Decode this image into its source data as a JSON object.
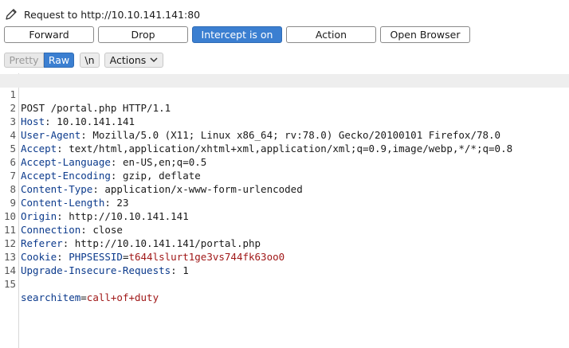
{
  "window": {
    "title": "Request to http://10.10.141.141:80",
    "icon": "pencil-icon"
  },
  "buttons": {
    "forward": "Forward",
    "drop": "Drop",
    "intercept": "Intercept is on",
    "action": "Action",
    "open_browser": "Open Browser"
  },
  "tabs": {
    "pretty": "Pretty",
    "raw": "Raw",
    "newline": "\\n",
    "actions": "Actions"
  },
  "colors": {
    "accent": "#3b7fd1",
    "header_name": "#0b3a8c",
    "param_value": "#a01818"
  },
  "request": {
    "line_numbers": [
      "1",
      "2",
      "3",
      "4",
      "5",
      "6",
      "7",
      "8",
      "9",
      "10",
      "11",
      "12",
      "13",
      "14",
      "15"
    ],
    "request_line": "POST /portal.php HTTP/1.1",
    "headers": [
      {
        "name": "Host",
        "value": "10.10.141.141"
      },
      {
        "name": "User-Agent",
        "value": "Mozilla/5.0 (X11; Linux x86_64; rv:78.0) Gecko/20100101 Firefox/78.0"
      },
      {
        "name": "Accept",
        "value": "text/html,application/xhtml+xml,application/xml;q=0.9,image/webp,*/*;q=0.8"
      },
      {
        "name": "Accept-Language",
        "value": "en-US,en;q=0.5"
      },
      {
        "name": "Accept-Encoding",
        "value": "gzip, deflate"
      },
      {
        "name": "Content-Type",
        "value": "application/x-www-form-urlencoded"
      },
      {
        "name": "Content-Length",
        "value": "23"
      },
      {
        "name": "Origin",
        "value": "http://10.10.141.141"
      },
      {
        "name": "Connection",
        "value": "close"
      },
      {
        "name": "Referer",
        "value": "http://10.10.141.141/portal.php"
      }
    ],
    "cookie": {
      "name": "Cookie",
      "param": "PHPSESSID",
      "value": "t644lslurt1ge3vs744fk63oo0"
    },
    "upgrade": {
      "name": "Upgrade-Insecure-Requests",
      "value": "1"
    },
    "body": {
      "param": "searchitem",
      "value": "call+of+duty"
    }
  }
}
